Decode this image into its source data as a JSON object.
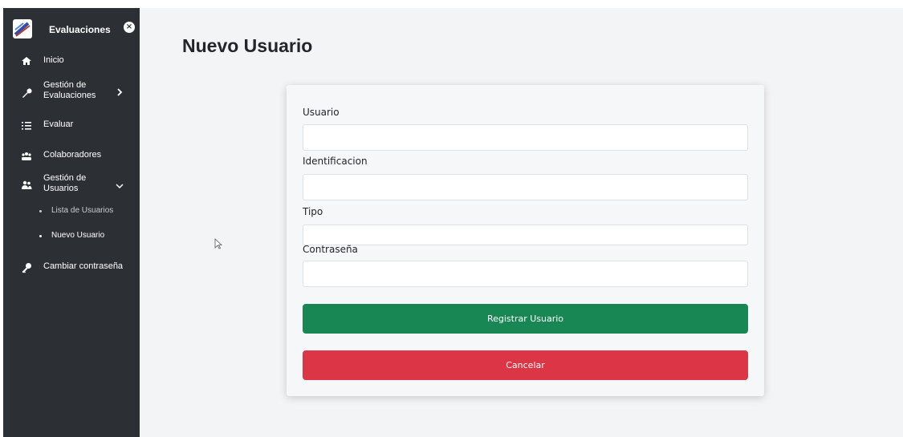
{
  "sidebar": {
    "title": "Evaluaciones",
    "close_symbol": "×",
    "items": [
      {
        "label": "Inicio",
        "icon": "home-icon"
      },
      {
        "label": "Gestión de Evaluaciones",
        "icon": "wrench-icon"
      },
      {
        "label": "Evaluar",
        "icon": "list-icon"
      },
      {
        "label": "Colaboradores",
        "icon": "group-icon"
      },
      {
        "label": "Gestión de Usuarios",
        "icon": "users-icon"
      },
      {
        "label": "Cambiar contraseña",
        "icon": "key-icon"
      }
    ],
    "subitems": [
      {
        "label": "Lista de Usuarios"
      },
      {
        "label": "Nuevo Usuario"
      }
    ]
  },
  "main": {
    "title": "Nuevo Usuario"
  },
  "form": {
    "usuario": {
      "label": "Usuario",
      "value": ""
    },
    "identificacion": {
      "label": "Identificacion",
      "value": ""
    },
    "tipo": {
      "label": "Tipo",
      "value": ""
    },
    "contrasena": {
      "label": "Contraseña",
      "value": ""
    },
    "submit_label": "Registrar Usuario",
    "cancel_label": "Cancelar"
  },
  "colors": {
    "sidebar_bg": "#2c3035",
    "success": "#198754",
    "danger": "#dc3545"
  }
}
